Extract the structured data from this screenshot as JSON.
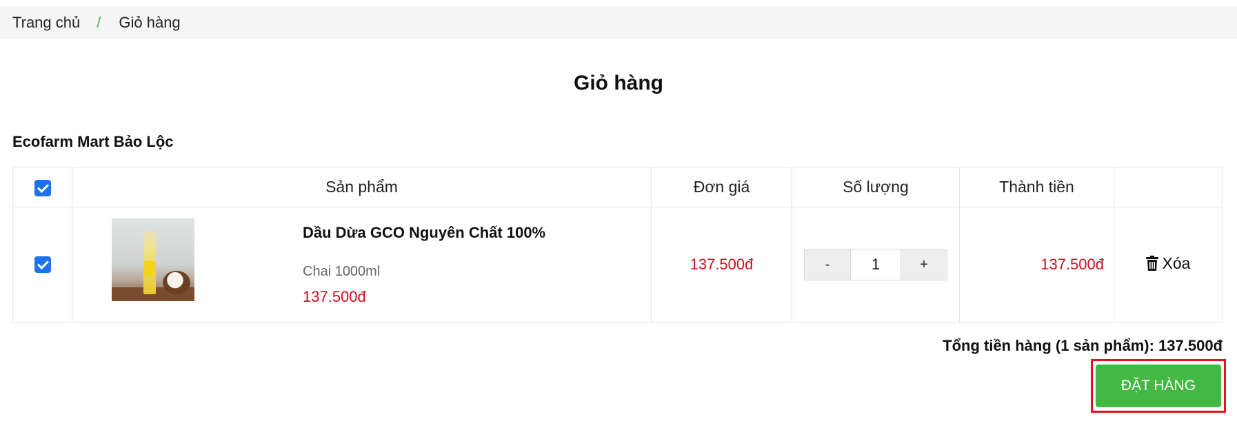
{
  "breadcrumb": {
    "home": "Trang chủ",
    "separator": "/",
    "current": "Giỏ hàng"
  },
  "page_title": "Giỏ hàng",
  "shop_name": "Ecofarm Mart Bảo Lộc",
  "table": {
    "headers": {
      "product": "Sản phẩm",
      "unit_price": "Đơn giá",
      "quantity": "Số lượng",
      "subtotal": "Thành tiền"
    },
    "select_all_checked": true,
    "rows": [
      {
        "checked": true,
        "name": "Dầu Dừa GCO Nguyên Chất 100%",
        "variant": "Chai 1000ml",
        "price": "137.500đ",
        "unit_price": "137.500đ",
        "quantity": "1",
        "qty_minus": "-",
        "qty_plus": "+",
        "subtotal": "137.500đ",
        "delete_label": "Xóa"
      }
    ]
  },
  "summary": "Tổng tiền hàng (1 sản phẩm): 137.500đ",
  "order_button": "ĐẶT HÀNG",
  "colors": {
    "accent_green": "#43b843",
    "price_red": "#d10d1e",
    "checkbox_blue": "#1a73e8",
    "highlight_red": "#e8101f"
  }
}
